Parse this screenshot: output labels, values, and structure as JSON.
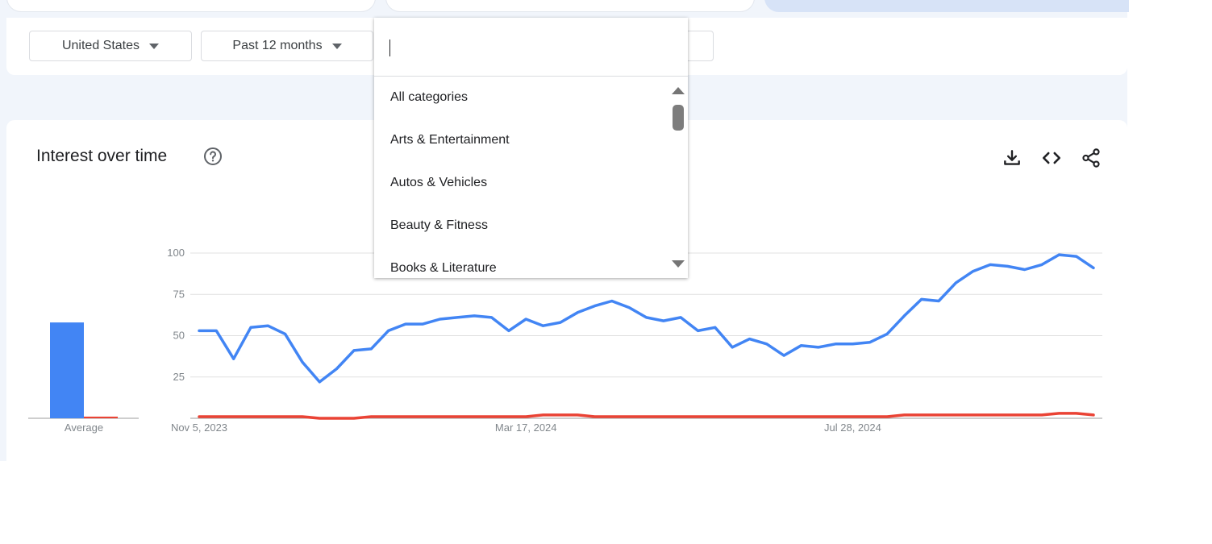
{
  "filters": {
    "region": "United States",
    "time_range": "Past 12 months"
  },
  "category_dropdown": {
    "search_value": "",
    "options": [
      "All categories",
      "Arts & Entertainment",
      "Autos & Vehicles",
      "Beauty & Fitness",
      "Books & Literature"
    ]
  },
  "chart_card": {
    "title": "Interest over time",
    "icons": [
      "help-icon",
      "download-icon",
      "embed-icon",
      "share-icon"
    ]
  },
  "colors": {
    "series_1": "#4285f4",
    "series_2": "#ea4335",
    "grid": "#e0e0e0",
    "axis_text": "#80868b"
  },
  "chart_data": [
    {
      "type": "bar",
      "categories": [
        "Average"
      ],
      "series": [
        {
          "values": [
            58
          ]
        },
        {
          "values": [
            1
          ]
        }
      ],
      "ylim": [
        0,
        100
      ]
    },
    {
      "type": "line",
      "x_tick_labels": [
        "Nov 5, 2023",
        "Mar 17, 2024",
        "Jul 28, 2024"
      ],
      "y_ticks": [
        25,
        50,
        75,
        100
      ],
      "ylim": [
        0,
        100
      ],
      "grid": true,
      "series": [
        {
          "values": [
            53,
            53,
            36,
            55,
            56,
            51,
            34,
            22,
            30,
            41,
            42,
            53,
            57,
            57,
            60,
            61,
            62,
            61,
            53,
            60,
            56,
            58,
            64,
            68,
            71,
            67,
            61,
            59,
            61,
            53,
            55,
            43,
            48,
            45,
            38,
            44,
            43,
            45,
            45,
            46,
            51,
            62,
            72,
            71,
            82,
            89,
            93,
            92,
            90,
            93,
            99,
            98,
            91
          ]
        },
        {
          "values": [
            1,
            1,
            1,
            1,
            1,
            1,
            1,
            0,
            0,
            0,
            1,
            1,
            1,
            1,
            1,
            1,
            1,
            1,
            1,
            1,
            2,
            2,
            2,
            1,
            1,
            1,
            1,
            1,
            1,
            1,
            1,
            1,
            1,
            1,
            1,
            1,
            1,
            1,
            1,
            1,
            1,
            2,
            2,
            2,
            2,
            2,
            2,
            2,
            2,
            2,
            3,
            3,
            2
          ]
        }
      ]
    }
  ]
}
